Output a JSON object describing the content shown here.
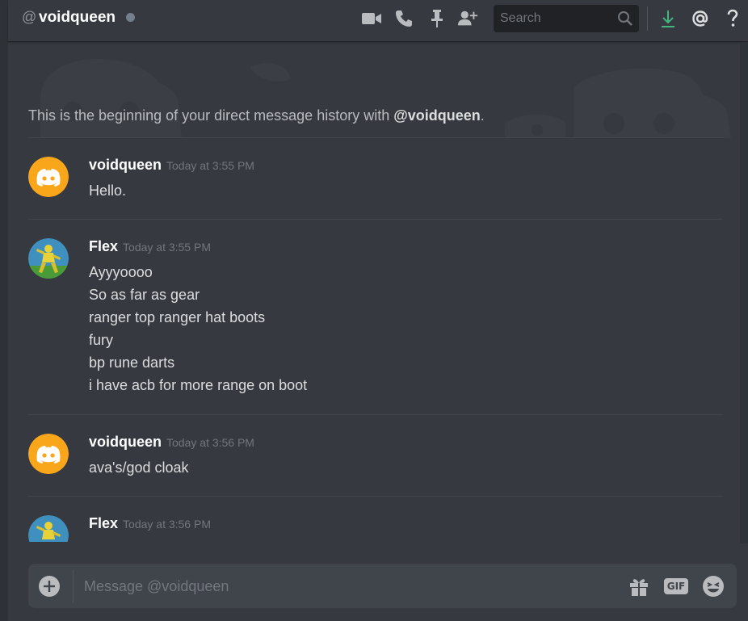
{
  "header": {
    "at_symbol": "@",
    "title": "voidqueen",
    "status": "offline",
    "search_placeholder": "Search",
    "icons": [
      "video-call-icon",
      "voice-call-icon",
      "pin-icon",
      "add-friend-icon",
      "search-icon",
      "download-icon",
      "mention-icon",
      "help-icon"
    ]
  },
  "intro": {
    "prefix": "This is the beginning of your direct message history with ",
    "handle": "@voidqueen",
    "suffix": "."
  },
  "messages": [
    {
      "username": "voidqueen",
      "timestamp": "Today at 3:55 PM",
      "avatar": "discord-default-avatar",
      "lines": [
        "Hello."
      ]
    },
    {
      "username": "Flex",
      "timestamp": "Today at 3:55 PM",
      "avatar": "user-avatar",
      "lines": [
        "Ayyyoooo",
        "So as far as gear",
        "ranger top ranger hat boots",
        "fury",
        "bp rune darts",
        "i have acb for more range on boot"
      ]
    },
    {
      "username": "voidqueen",
      "timestamp": "Today at 3:56 PM",
      "avatar": "discord-default-avatar",
      "lines": [
        "ava's/god cloak"
      ]
    },
    {
      "username": "Flex",
      "timestamp": "Today at 3:56 PM",
      "avatar": "user-avatar",
      "lines": []
    }
  ],
  "composer": {
    "placeholder": "Message @voidqueen",
    "gif_label": "GIF",
    "icons": [
      "add-attachment-icon",
      "gift-icon",
      "gif-icon",
      "emoji-icon"
    ]
  },
  "colors": {
    "background": "#36393f",
    "header_bg": "#36393f",
    "composer_bg": "#40444b",
    "discord_orange": "#faa61a",
    "download_green": "#43b581",
    "username": "#ffffff",
    "timestamp": "#72767d"
  }
}
